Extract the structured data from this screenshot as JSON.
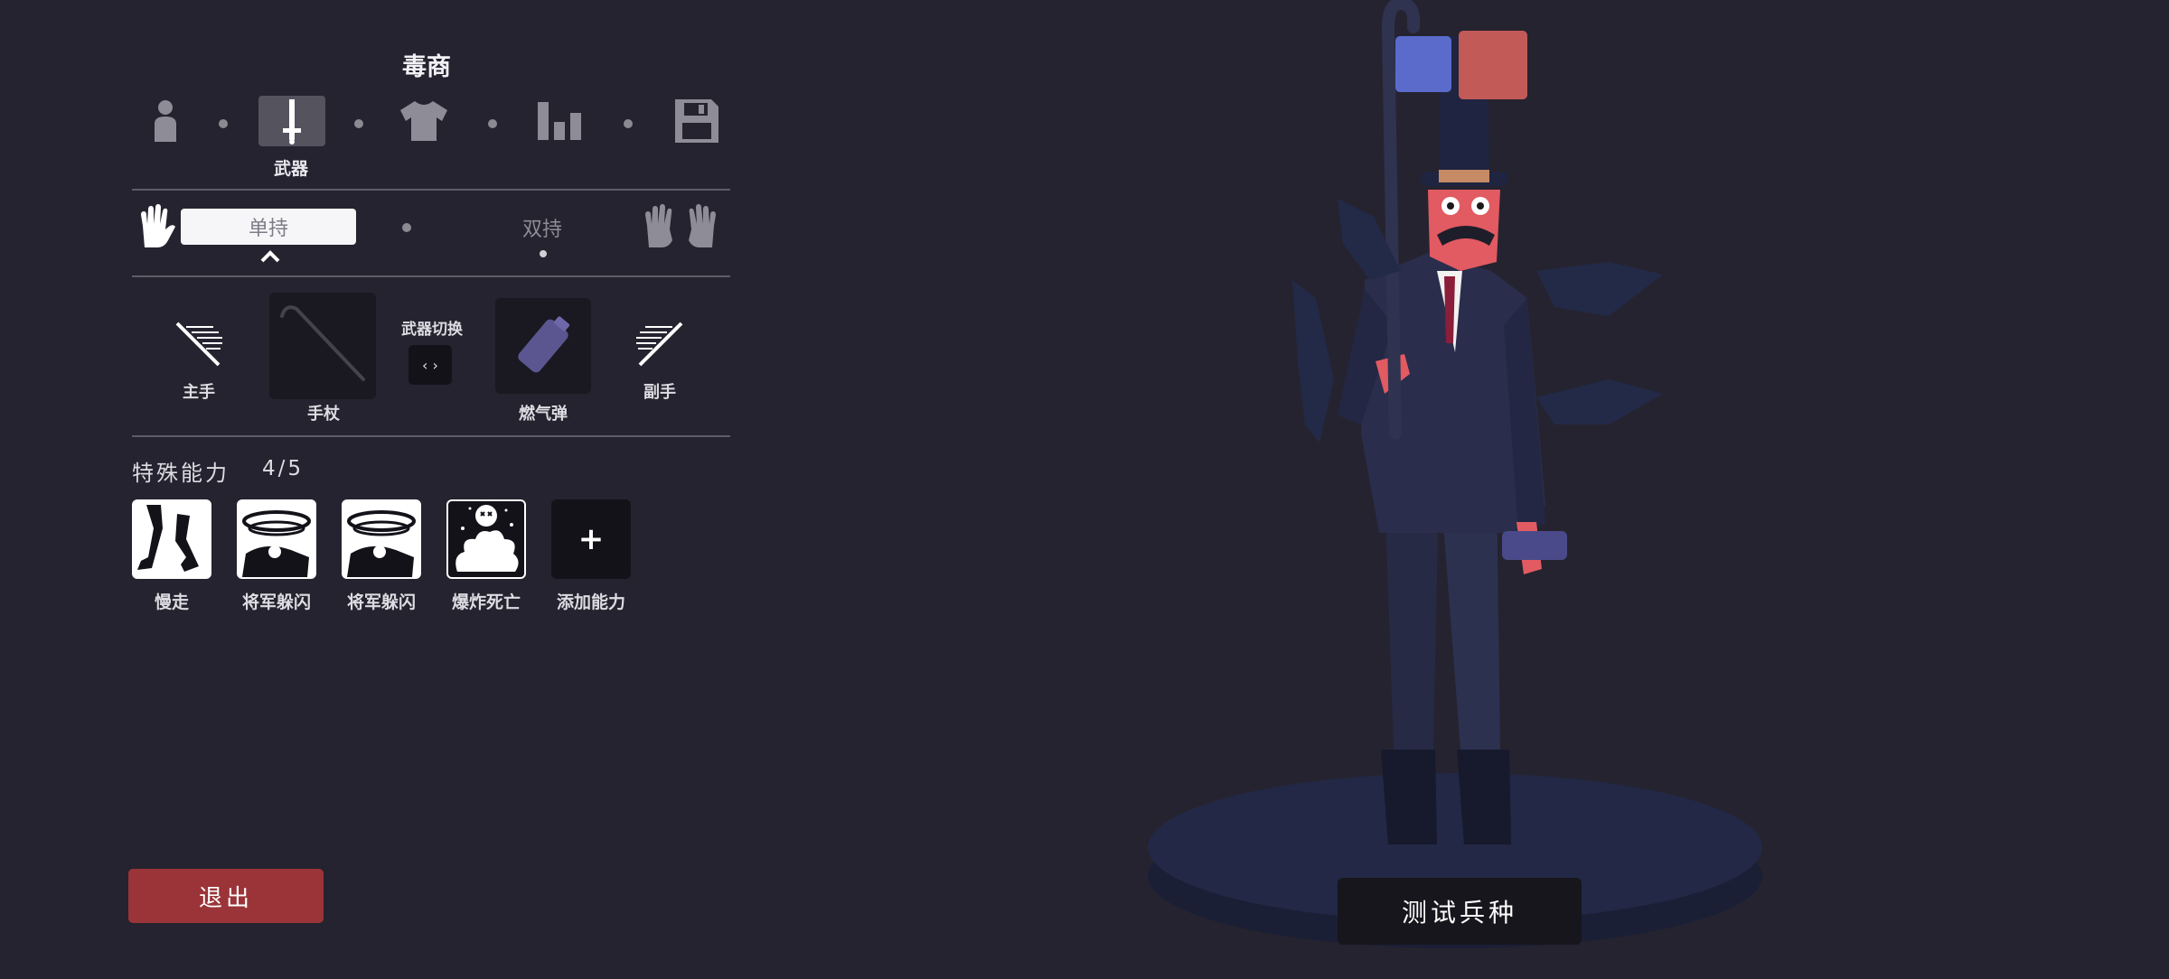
{
  "unit_name": "毒商",
  "tabs": {
    "items": [
      {
        "icon": "character-icon"
      },
      {
        "icon": "weapon-icon",
        "label": "武器",
        "active": true
      },
      {
        "icon": "clothing-icon"
      },
      {
        "icon": "stats-icon"
      },
      {
        "icon": "save-icon"
      }
    ]
  },
  "grip": {
    "single_label": "单持",
    "dual_label": "双持",
    "single_icon": "single-hand-icon",
    "dual_icon": "two-hands-icon"
  },
  "weapons": {
    "main_hand_label": "主手",
    "main_weapon_label": "手杖",
    "swap_label": "武器切换",
    "swap_icon": "‹ ›",
    "off_weapon_label": "燃气弹",
    "off_hand_label": "副手"
  },
  "abilities": {
    "title": "特殊能力",
    "count": "4/5",
    "items": [
      {
        "label": "慢走",
        "icon": "slow-walk-icon"
      },
      {
        "label": "将军躲闪",
        "icon": "general-dodge-icon"
      },
      {
        "label": "将军躲闪",
        "icon": "general-dodge-icon"
      },
      {
        "label": "爆炸死亡",
        "icon": "explode-death-icon"
      }
    ],
    "add_label": "添加能力",
    "add_symbol": "+"
  },
  "exit_label": "退出",
  "test_label": "测试兵种",
  "colors": {
    "background": "#25232f",
    "team_blue": "#5b6bcc",
    "team_red": "#c25a58",
    "exit_button": "#9b3438",
    "character_skin": "#e25a62",
    "suit": "#262a45"
  }
}
